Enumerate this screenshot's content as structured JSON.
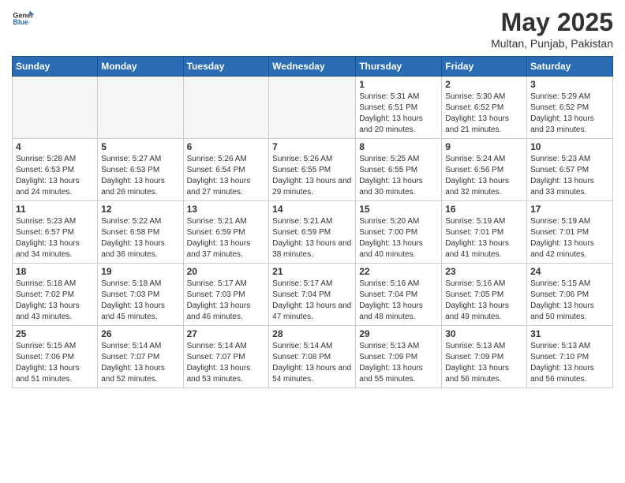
{
  "header": {
    "logo": {
      "general": "General",
      "blue": "Blue"
    },
    "title": "May 2025",
    "location": "Multan, Punjab, Pakistan"
  },
  "weekdays": [
    "Sunday",
    "Monday",
    "Tuesday",
    "Wednesday",
    "Thursday",
    "Friday",
    "Saturday"
  ],
  "weeks": [
    [
      {
        "day": "",
        "empty": true
      },
      {
        "day": "",
        "empty": true
      },
      {
        "day": "",
        "empty": true
      },
      {
        "day": "",
        "empty": true
      },
      {
        "day": "1",
        "sunrise": "5:31 AM",
        "sunset": "6:51 PM",
        "daylight": "13 hours and 20 minutes."
      },
      {
        "day": "2",
        "sunrise": "5:30 AM",
        "sunset": "6:52 PM",
        "daylight": "13 hours and 21 minutes."
      },
      {
        "day": "3",
        "sunrise": "5:29 AM",
        "sunset": "6:52 PM",
        "daylight": "13 hours and 23 minutes."
      }
    ],
    [
      {
        "day": "4",
        "sunrise": "5:28 AM",
        "sunset": "6:53 PM",
        "daylight": "13 hours and 24 minutes."
      },
      {
        "day": "5",
        "sunrise": "5:27 AM",
        "sunset": "6:53 PM",
        "daylight": "13 hours and 26 minutes."
      },
      {
        "day": "6",
        "sunrise": "5:26 AM",
        "sunset": "6:54 PM",
        "daylight": "13 hours and 27 minutes."
      },
      {
        "day": "7",
        "sunrise": "5:26 AM",
        "sunset": "6:55 PM",
        "daylight": "13 hours and 29 minutes."
      },
      {
        "day": "8",
        "sunrise": "5:25 AM",
        "sunset": "6:55 PM",
        "daylight": "13 hours and 30 minutes."
      },
      {
        "day": "9",
        "sunrise": "5:24 AM",
        "sunset": "6:56 PM",
        "daylight": "13 hours and 32 minutes."
      },
      {
        "day": "10",
        "sunrise": "5:23 AM",
        "sunset": "6:57 PM",
        "daylight": "13 hours and 33 minutes."
      }
    ],
    [
      {
        "day": "11",
        "sunrise": "5:23 AM",
        "sunset": "6:57 PM",
        "daylight": "13 hours and 34 minutes."
      },
      {
        "day": "12",
        "sunrise": "5:22 AM",
        "sunset": "6:58 PM",
        "daylight": "13 hours and 36 minutes."
      },
      {
        "day": "13",
        "sunrise": "5:21 AM",
        "sunset": "6:59 PM",
        "daylight": "13 hours and 37 minutes."
      },
      {
        "day": "14",
        "sunrise": "5:21 AM",
        "sunset": "6:59 PM",
        "daylight": "13 hours and 38 minutes."
      },
      {
        "day": "15",
        "sunrise": "5:20 AM",
        "sunset": "7:00 PM",
        "daylight": "13 hours and 40 minutes."
      },
      {
        "day": "16",
        "sunrise": "5:19 AM",
        "sunset": "7:01 PM",
        "daylight": "13 hours and 41 minutes."
      },
      {
        "day": "17",
        "sunrise": "5:19 AM",
        "sunset": "7:01 PM",
        "daylight": "13 hours and 42 minutes."
      }
    ],
    [
      {
        "day": "18",
        "sunrise": "5:18 AM",
        "sunset": "7:02 PM",
        "daylight": "13 hours and 43 minutes."
      },
      {
        "day": "19",
        "sunrise": "5:18 AM",
        "sunset": "7:03 PM",
        "daylight": "13 hours and 45 minutes."
      },
      {
        "day": "20",
        "sunrise": "5:17 AM",
        "sunset": "7:03 PM",
        "daylight": "13 hours and 46 minutes."
      },
      {
        "day": "21",
        "sunrise": "5:17 AM",
        "sunset": "7:04 PM",
        "daylight": "13 hours and 47 minutes."
      },
      {
        "day": "22",
        "sunrise": "5:16 AM",
        "sunset": "7:04 PM",
        "daylight": "13 hours and 48 minutes."
      },
      {
        "day": "23",
        "sunrise": "5:16 AM",
        "sunset": "7:05 PM",
        "daylight": "13 hours and 49 minutes."
      },
      {
        "day": "24",
        "sunrise": "5:15 AM",
        "sunset": "7:06 PM",
        "daylight": "13 hours and 50 minutes."
      }
    ],
    [
      {
        "day": "25",
        "sunrise": "5:15 AM",
        "sunset": "7:06 PM",
        "daylight": "13 hours and 51 minutes."
      },
      {
        "day": "26",
        "sunrise": "5:14 AM",
        "sunset": "7:07 PM",
        "daylight": "13 hours and 52 minutes."
      },
      {
        "day": "27",
        "sunrise": "5:14 AM",
        "sunset": "7:07 PM",
        "daylight": "13 hours and 53 minutes."
      },
      {
        "day": "28",
        "sunrise": "5:14 AM",
        "sunset": "7:08 PM",
        "daylight": "13 hours and 54 minutes."
      },
      {
        "day": "29",
        "sunrise": "5:13 AM",
        "sunset": "7:09 PM",
        "daylight": "13 hours and 55 minutes."
      },
      {
        "day": "30",
        "sunrise": "5:13 AM",
        "sunset": "7:09 PM",
        "daylight": "13 hours and 56 minutes."
      },
      {
        "day": "31",
        "sunrise": "5:13 AM",
        "sunset": "7:10 PM",
        "daylight": "13 hours and 56 minutes."
      }
    ]
  ],
  "labels": {
    "sunrise": "Sunrise:",
    "sunset": "Sunset:",
    "daylight": "Daylight:"
  }
}
